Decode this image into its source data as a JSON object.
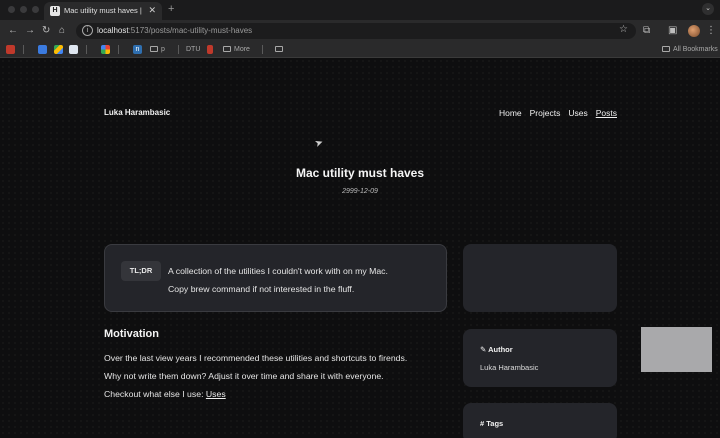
{
  "browser": {
    "tab_title": "Mac utility must haves | Luka",
    "tab_favicon": "H",
    "url_host": "localhost",
    "url_path": ":5173/posts/mac-utility-must-haves",
    "bookmarks": {
      "p_label": "p",
      "dtu_label": "DTU",
      "more_label": "More",
      "all_bookmarks_label": "All Bookmarks"
    }
  },
  "site": {
    "name": "Luka Harambasic",
    "nav": [
      "Home",
      "Projects",
      "Uses",
      "Posts"
    ]
  },
  "post": {
    "title": "Mac utility must haves",
    "date": "2999-12-09",
    "tldr_label": "TL;DR",
    "tldr_line1": "A collection of the utilities I couldn't work with on my Mac.",
    "tldr_line2": "Copy brew command if not interested in the fluff.",
    "motivation_heading": "Motivation",
    "para1": "Over the last view years I recommended these utilities and shortcuts to firends.",
    "para2": "Why not write them down? Adjust it over time and share it with everyone.",
    "para3_prefix": "Checkout what else I use: ",
    "para3_link": "Uses"
  },
  "sidebar": {
    "author_heading": "Author",
    "author_name": "Luka Harambasic",
    "tags_heading": "Tags"
  },
  "icons": {
    "tldr_badge": "badge",
    "author": "pencil-icon",
    "tags": "hash-icon"
  }
}
